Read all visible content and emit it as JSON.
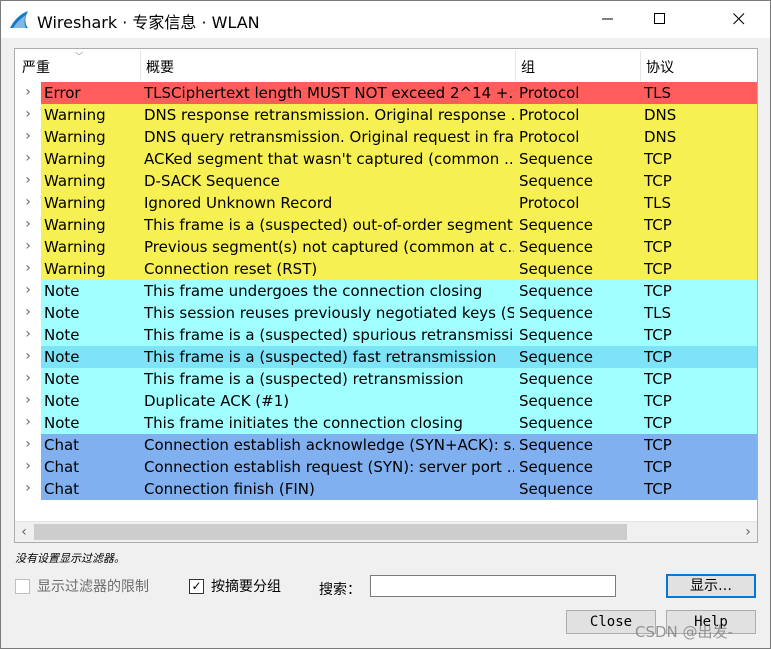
{
  "window": {
    "title": "Wireshark · 专家信息 · WLAN",
    "minimize_icon": "minimize-icon",
    "maximize_icon": "maximize-icon",
    "close_icon": "close-icon"
  },
  "columns": {
    "severity": "严重",
    "summary": "概要",
    "group": "组",
    "protocol": "协议"
  },
  "severity_colors": {
    "Error": "#ff5c5c",
    "Warning": "#f7f052",
    "Note": "#a0ffff",
    "Chat": "#80b0f0",
    "selected_note": "#7de3f7"
  },
  "rows": [
    {
      "severity": "Error",
      "summary": "TLSCiphertext length MUST NOT exceed 2^14 +...",
      "group": "Protocol",
      "protocol": "TLS"
    },
    {
      "severity": "Warning",
      "summary": "DNS response retransmission. Original response ...",
      "group": "Protocol",
      "protocol": "DNS"
    },
    {
      "severity": "Warning",
      "summary": "DNS query retransmission. Original request in fra...",
      "group": "Protocol",
      "protocol": "DNS"
    },
    {
      "severity": "Warning",
      "summary": "ACKed segment that wasn't captured (common ...",
      "group": "Sequence",
      "protocol": "TCP"
    },
    {
      "severity": "Warning",
      "summary": "D-SACK Sequence",
      "group": "Sequence",
      "protocol": "TCP"
    },
    {
      "severity": "Warning",
      "summary": "Ignored Unknown Record",
      "group": "Protocol",
      "protocol": "TLS"
    },
    {
      "severity": "Warning",
      "summary": "This frame is a (suspected) out-of-order segment",
      "group": "Sequence",
      "protocol": "TCP"
    },
    {
      "severity": "Warning",
      "summary": "Previous segment(s) not captured (common at c...",
      "group": "Sequence",
      "protocol": "TCP"
    },
    {
      "severity": "Warning",
      "summary": "Connection reset (RST)",
      "group": "Sequence",
      "protocol": "TCP"
    },
    {
      "severity": "Note",
      "summary": "This frame undergoes the connection closing",
      "group": "Sequence",
      "protocol": "TCP"
    },
    {
      "severity": "Note",
      "summary": "This session reuses previously negotiated keys (S...",
      "group": "Sequence",
      "protocol": "TLS"
    },
    {
      "severity": "Note",
      "summary": "This frame is a (suspected) spurious retransmission",
      "group": "Sequence",
      "protocol": "TCP"
    },
    {
      "severity": "Note",
      "summary": "This frame is a (suspected) fast retransmission",
      "group": "Sequence",
      "protocol": "TCP",
      "selected": true
    },
    {
      "severity": "Note",
      "summary": "This frame is a (suspected) retransmission",
      "group": "Sequence",
      "protocol": "TCP"
    },
    {
      "severity": "Note",
      "summary": "Duplicate ACK (#1)",
      "group": "Sequence",
      "protocol": "TCP"
    },
    {
      "severity": "Note",
      "summary": "This frame initiates the connection closing",
      "group": "Sequence",
      "protocol": "TCP"
    },
    {
      "severity": "Chat",
      "summary": "Connection establish acknowledge (SYN+ACK): s...",
      "group": "Sequence",
      "protocol": "TCP"
    },
    {
      "severity": "Chat",
      "summary": "Connection establish request (SYN): server port ...",
      "group": "Sequence",
      "protocol": "TCP"
    },
    {
      "severity": "Chat",
      "summary": "Connection finish (FIN)",
      "group": "Sequence",
      "protocol": "TCP"
    }
  ],
  "status_text": "没有设置显示过滤器。",
  "options": {
    "limit_to_display_filter": {
      "label": "显示过滤器的限制",
      "checked": false
    },
    "group_by_summary": {
      "label": "按摘要分组",
      "checked": true
    }
  },
  "search": {
    "label": "搜索：",
    "value": ""
  },
  "buttons": {
    "show": "显示…",
    "close": "Close",
    "help": "Help"
  },
  "watermark": "CSDN @出发-"
}
